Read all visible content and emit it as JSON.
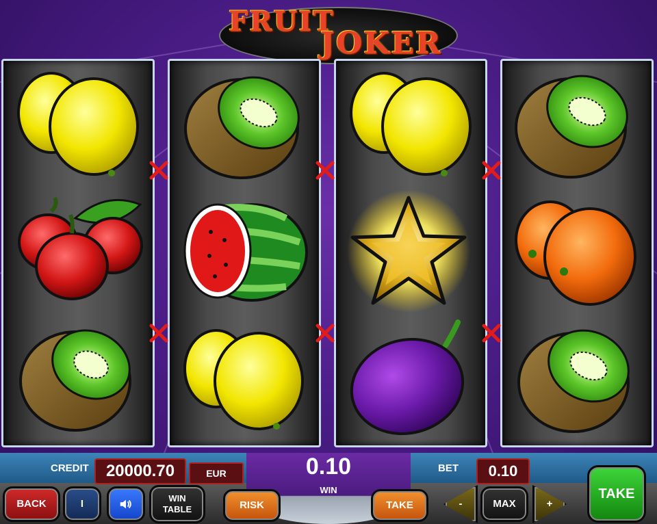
{
  "logo": {
    "word1": "FRUIT",
    "word2": "JOKER"
  },
  "reels": [
    {
      "id": 1,
      "symbols": [
        "lemon",
        "cherry",
        "kiwi"
      ]
    },
    {
      "id": 2,
      "symbols": [
        "kiwi",
        "watermelon",
        "lemon"
      ]
    },
    {
      "id": 3,
      "symbols": [
        "lemon",
        "star",
        "plum"
      ]
    },
    {
      "id": 4,
      "symbols": [
        "kiwi",
        "orange",
        "kiwi"
      ]
    }
  ],
  "payline_markers": [
    "x-marker",
    "x-marker",
    "x-marker",
    "x-marker",
    "x-marker",
    "x-marker"
  ],
  "panel": {
    "credit_label": "CREDIT",
    "credit_value": "20000.70",
    "currency": "EUR",
    "win_value": "0.10",
    "win_label": "WIN",
    "bet_label": "BET",
    "bet_value": "0.10"
  },
  "buttons": {
    "back": "BACK",
    "info": "I",
    "sound_icon": "speaker-icon",
    "win_table_line1": "WIN",
    "win_table_line2": "TABLE",
    "risk": "RISK",
    "take_small": "TAKE",
    "minus": "-",
    "max": "MAX",
    "plus": "+",
    "take": "TAKE"
  },
  "colors": {
    "background": "#4a1d86",
    "reel_border": "#c8d7ee",
    "take_green": "#3ed63a",
    "risk_orange": "#f2922e",
    "value_box": "#5a0f12"
  }
}
